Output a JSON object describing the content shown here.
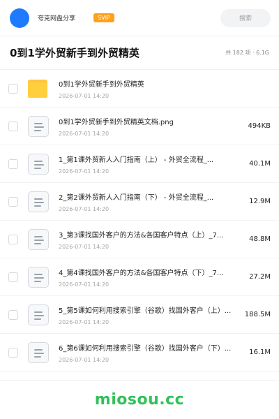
{
  "header": {
    "brand": "夸克网盘分享",
    "badge": "SVIP",
    "search_placeholder": "搜索"
  },
  "page": {
    "title": "0到1学外贸新手到外贸精英",
    "summary": "共 182 项 · 6.1G"
  },
  "files": [
    {
      "type": "folder",
      "name": "0到1学外贸新手到外贸精英",
      "time": "2026-07-01 14:20",
      "size": ""
    },
    {
      "type": "doc",
      "name": "0到1学外贸新手到外贸精英文档.png",
      "time": "2026-07-01 14:20",
      "size": "494KB"
    },
    {
      "type": "doc",
      "name": "1_第1课外贸新人入门指南（上） - 外贸全流程_...",
      "time": "2026-07-01 14:20",
      "size": "40.1M"
    },
    {
      "type": "doc",
      "name": "2_第2课外贸新人入门指南（下） - 外贸全流程_...",
      "time": "2026-07-01 14:20",
      "size": "12.9M"
    },
    {
      "type": "doc",
      "name": "3_第3课找国外客户的方法&各国客户特点（上）_7...",
      "time": "2026-07-01 14:20",
      "size": "48.8M"
    },
    {
      "type": "doc",
      "name": "4_第4课找国外客户的方法&各国客户特点（下）_7...",
      "time": "2026-07-01 14:20",
      "size": "27.2M"
    },
    {
      "type": "doc",
      "name": "5_第5课如何利用搜索引擎（谷歌）找国外客户（上）...",
      "time": "2026-07-01 14:20",
      "size": "188.5M"
    },
    {
      "type": "doc",
      "name": "6_第6课如何利用搜索引擎（谷歌）找国外客户（下）...",
      "time": "2026-07-01 14:20",
      "size": "16.1M"
    }
  ],
  "watermark": "miosou.cc",
  "colors": {
    "accent": "#1e7bff",
    "badge": "#ffa11a",
    "folder": "#ffcf3d",
    "watermark": "#31c25a"
  }
}
